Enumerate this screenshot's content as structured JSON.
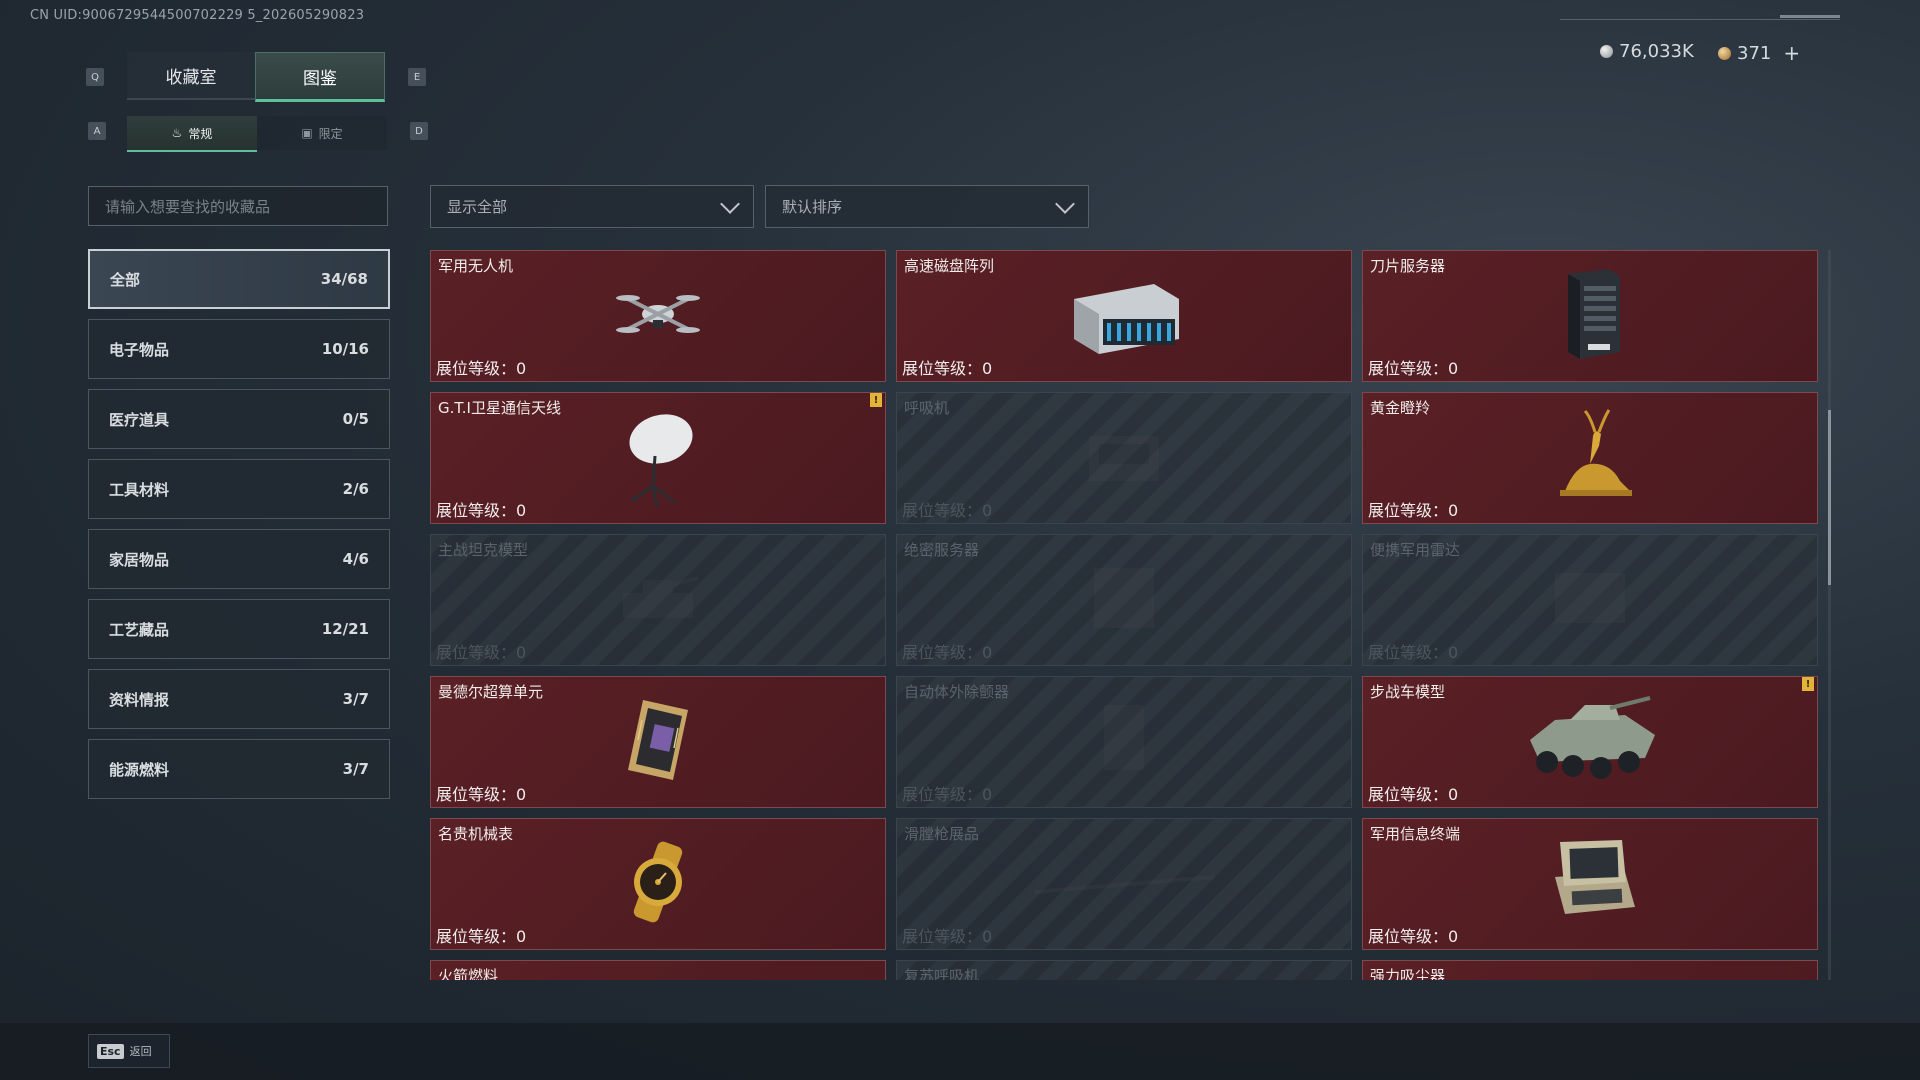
{
  "uid": "CN UID:9006729544500702229 5_202605290823",
  "currency": {
    "silver": "76,033K",
    "gold": "371",
    "plus": "+"
  },
  "keys": {
    "q": "Q",
    "e": "E",
    "a": "A",
    "d": "D"
  },
  "tabs": [
    {
      "label": "收藏室"
    },
    {
      "label": "图鉴"
    }
  ],
  "subtabs": [
    {
      "label": "常规"
    },
    {
      "label": "限定"
    }
  ],
  "search": {
    "placeholder": "请输入想要查找的收藏品"
  },
  "filters": {
    "show": "显示全部",
    "sort": "默认排序"
  },
  "categories": [
    {
      "label": "全部",
      "count": "34/68"
    },
    {
      "label": "电子物品",
      "count": "10/16"
    },
    {
      "label": "医疗道具",
      "count": "0/5"
    },
    {
      "label": "工具材料",
      "count": "2/6"
    },
    {
      "label": "家居物品",
      "count": "4/6"
    },
    {
      "label": "工艺藏品",
      "count": "12/21"
    },
    {
      "label": "资料情报",
      "count": "3/7"
    },
    {
      "label": "能源燃料",
      "count": "3/7"
    }
  ],
  "level_label": "展位等级：0",
  "items": [
    {
      "name": "军用无人机",
      "locked": false,
      "icon": "drone-icon"
    },
    {
      "name": "高速磁盘阵列",
      "locked": false,
      "icon": "disk-array-icon"
    },
    {
      "name": "刀片服务器",
      "locked": false,
      "icon": "blade-server-icon"
    },
    {
      "name": "G.T.I卫星通信天线",
      "locked": false,
      "icon": "satellite-dish-icon",
      "badge": "!"
    },
    {
      "name": "呼吸机",
      "locked": true,
      "icon": "ventilator-icon"
    },
    {
      "name": "黄金瞪羚",
      "locked": false,
      "icon": "golden-gazelle-icon"
    },
    {
      "name": "主战坦克模型",
      "locked": true,
      "icon": "tank-model-icon"
    },
    {
      "name": "绝密服务器",
      "locked": true,
      "icon": "server-icon"
    },
    {
      "name": "便携军用雷达",
      "locked": true,
      "icon": "radar-icon"
    },
    {
      "name": "曼德尔超算单元",
      "locked": false,
      "icon": "supercomputer-unit-icon"
    },
    {
      "name": "自动体外除颤器",
      "locked": true,
      "icon": "defibrillator-icon"
    },
    {
      "name": "步战车模型",
      "locked": false,
      "icon": "ifv-model-icon",
      "badge": "!"
    },
    {
      "name": "名贵机械表",
      "locked": false,
      "icon": "watch-icon"
    },
    {
      "name": "滑膛枪展品",
      "locked": true,
      "icon": "musket-icon"
    },
    {
      "name": "军用信息终端",
      "locked": false,
      "icon": "terminal-icon"
    },
    {
      "name": "火箭燃料",
      "locked": false,
      "icon": "rocket-fuel-icon"
    },
    {
      "name": "复苏呼吸机",
      "locked": true,
      "icon": "resuscitator-icon"
    },
    {
      "name": "强力吸尘器",
      "locked": false,
      "icon": "vacuum-icon"
    }
  ],
  "esc": {
    "key": "Esc",
    "label": "返回"
  }
}
